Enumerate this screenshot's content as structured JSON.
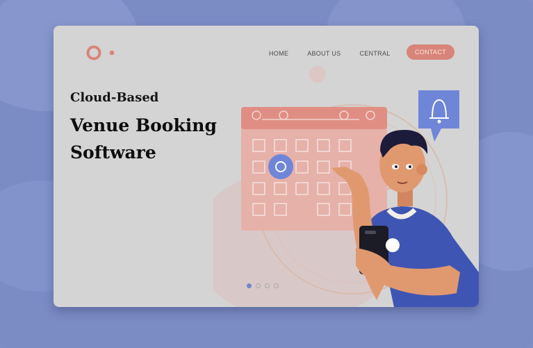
{
  "logo": {
    "name": "brand-logo-icon"
  },
  "nav": {
    "items": [
      {
        "label": "HOME"
      },
      {
        "label": "ABOUT US"
      },
      {
        "label": "CENTRAL"
      }
    ],
    "contact_label": "CONTACT"
  },
  "hero": {
    "subtitle": "Cloud-Based",
    "title_line1": "Venue Booking",
    "title_line2": "Software"
  },
  "carousel": {
    "total": 4,
    "active_index": 0
  },
  "illustration": {
    "icons": [
      "calendar-icon",
      "notification-bell-icon",
      "clock-icon",
      "smartphone-icon",
      "person-illustration"
    ]
  },
  "colors": {
    "background": "#7b8bc4",
    "card": "#d4d4d4",
    "accent_coral": "#d9847a",
    "accent_blue": "#6f86d8",
    "shirt_blue": "#3f55b3"
  }
}
